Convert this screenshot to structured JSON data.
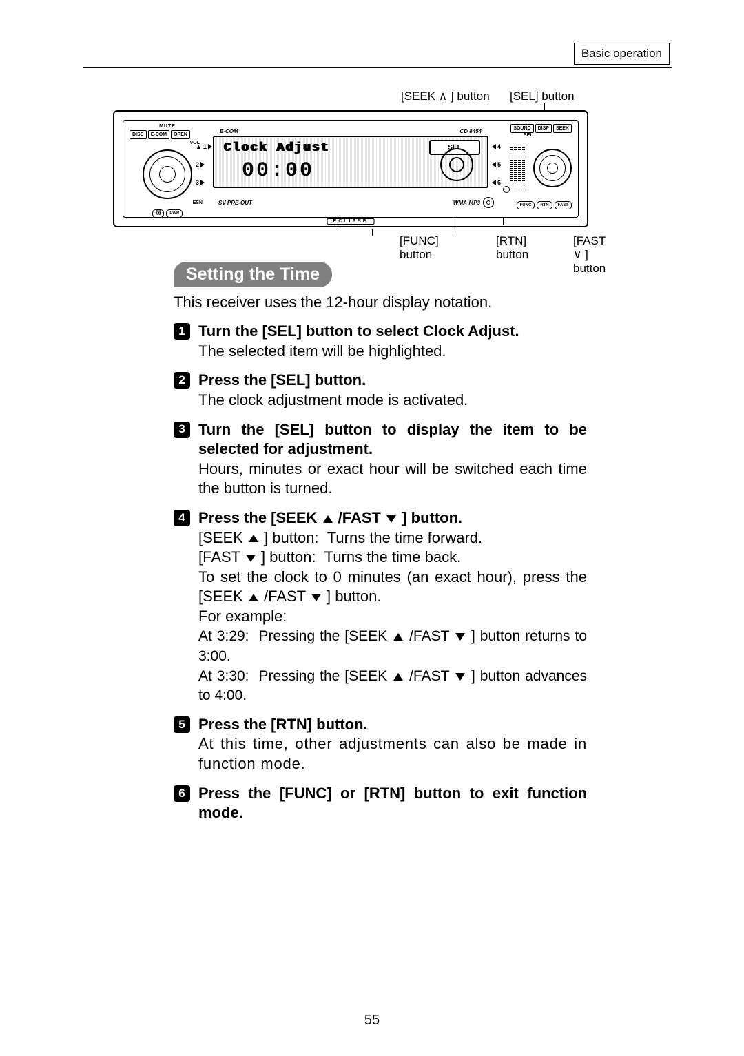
{
  "header": {
    "category": "Basic operation"
  },
  "callouts": {
    "top": {
      "seek": "[SEEK ∧ ] button",
      "sel": "[SEL] button"
    },
    "bottom": {
      "func": "[FUNC] button",
      "rtn": "[RTN] button",
      "fast": "[FAST ∨ ] button"
    }
  },
  "device": {
    "top_left_buttons": [
      "DISC",
      "E-COM",
      "OPEN"
    ],
    "mute": "MUTE",
    "vol": "VOL",
    "fm_am": "FM\nAM",
    "pwr": "PWR",
    "esn": "ESN",
    "brand_left": "E-COM",
    "model": "CD 8454",
    "lcd_title": "Clock Adjust",
    "lcd_sel": "SEL",
    "lcd_time": "00:00",
    "sv_preout": "SV PRE-OUT",
    "wma_mp3": "WMA·MP3",
    "eclipse": "ECLIPSE",
    "top_right_buttons": [
      "SOUND",
      "DISP",
      "SEEK"
    ],
    "sel_small": "SEL",
    "bottom_right_buttons": [
      "FUNC",
      "RTN",
      "FAST"
    ],
    "preset_left": [
      "1",
      "2",
      "3"
    ],
    "preset_right": [
      "4",
      "5",
      "6"
    ]
  },
  "section": {
    "title": "Setting the Time",
    "intro": "This receiver uses the 12-hour display notation.",
    "steps": [
      {
        "head": "Turn the [SEL] button to select Clock Adjust.",
        "body": "The selected item will be highlighted."
      },
      {
        "head": "Press the [SEL] button.",
        "body": "The clock adjustment mode is activated."
      },
      {
        "head": "Turn the [SEL] button to display the item to be selected for adjustment.",
        "body": "Hours, minutes or exact hour will be switched each time the button is turned."
      },
      {
        "head_pre": "Press the [SEEK ",
        "head_mid": " /FAST ",
        "head_post": " ] button.",
        "lines": {
          "l1a": "[SEEK ",
          "l1b": " ] button:",
          "l1c": "Turns the time forward.",
          "l2a": "[FAST ",
          "l2b": " ] button:",
          "l2c": "Turns the time back.",
          "l3a": "To set the clock to 0 minutes (an exact hour), press the [SEEK ",
          "l3b": " /FAST ",
          "l3c": " ] button.",
          "l4": "For example:",
          "l5a": "At 3:29:",
          "l5b": "Pressing the [SEEK ",
          "l5c": " /FAST ",
          "l5d": " ] button returns to 3:00.",
          "l6a": "At 3:30:",
          "l6b": "Pressing the [SEEK ",
          "l6c": " /FAST ",
          "l6d": " ] button advances to 4:00."
        }
      },
      {
        "head": "Press the [RTN] button.",
        "body": "At this time, other adjustments can also be made in function mode."
      },
      {
        "head": "Press the [FUNC] or [RTN] button to exit function mode."
      }
    ]
  },
  "page_number": "55"
}
